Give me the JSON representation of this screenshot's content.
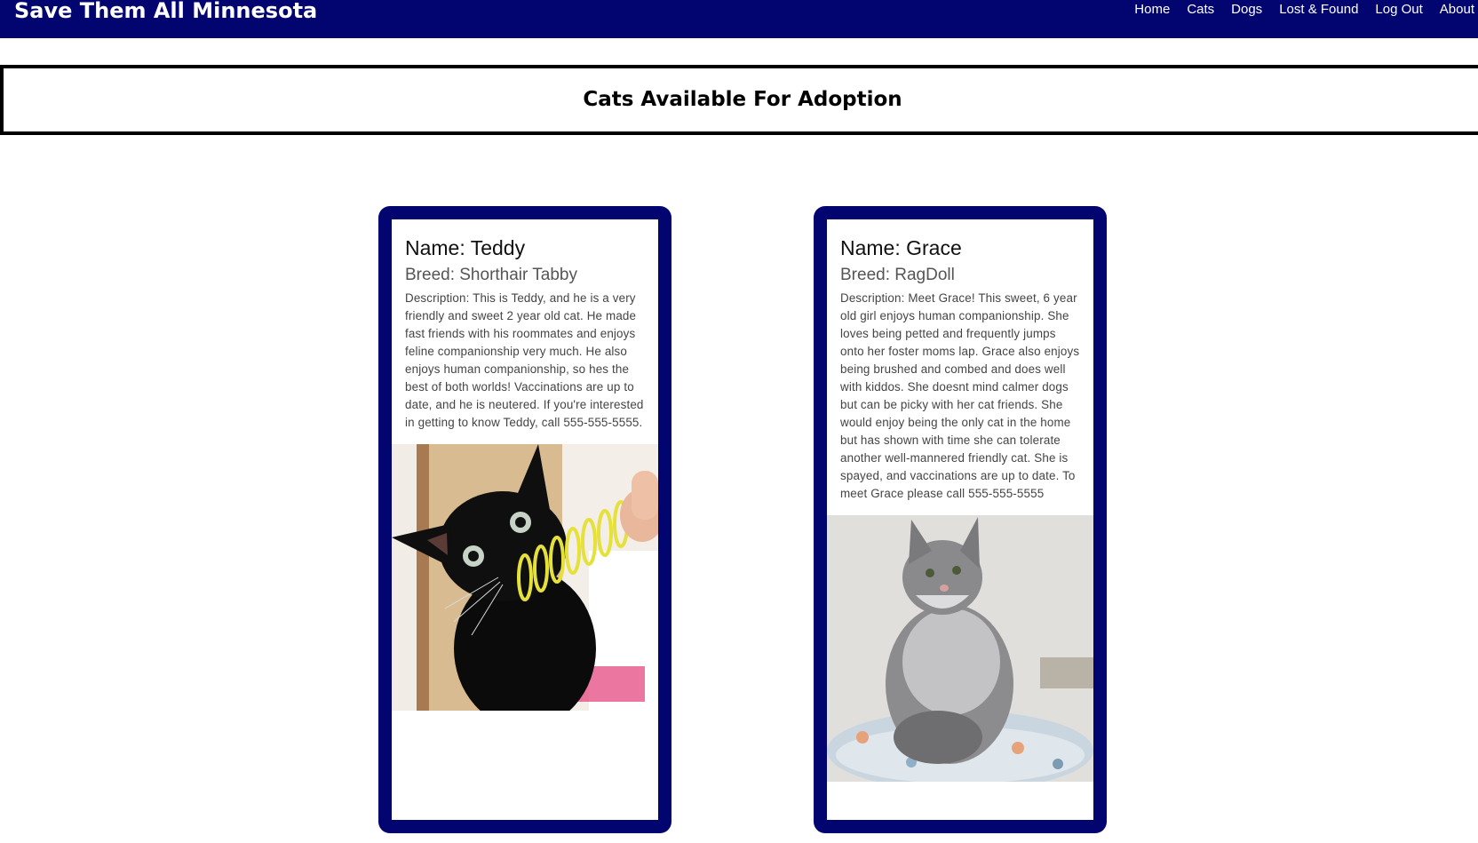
{
  "header": {
    "brand": "Save Them All Minnesota",
    "nav": [
      "Home",
      "Cats",
      "Dogs",
      "Lost & Found",
      "Log Out",
      "About"
    ]
  },
  "page": {
    "title": "Cats Available For Adoption"
  },
  "cats": [
    {
      "name": "Name: Teddy",
      "breed": "Breed: Shorthair Tabby",
      "description": "Description: This is Teddy, and he is a very friendly and sweet 2 year old cat. He made fast friends with his roommates and enjoys feline companionship very much. He also enjoys human companionship, so hes the best of both worlds! Vaccinations are up to date, and he is neutered. If you're interested in getting to know Teddy, call 555-555-5555."
    },
    {
      "name": "Name: Grace",
      "breed": "Breed: RagDoll",
      "description": "Description: Meet Grace! This sweet, 6 year old girl enjoys human companionship. She loves being petted and frequently jumps onto her foster moms lap. Grace also enjoys being brushed and combed and does well with kiddos. She doesnt mind calmer dogs but can be picky with her cat friends. She would enjoy being the only cat in the home but has shown with time she can tolerate another well-mannered friendly cat. She is spayed, and vaccinations are up to date. To meet Grace please call 555-555-5555"
    }
  ],
  "colors": {
    "navbar": "#020570",
    "card_border": "#020570",
    "heading_border": "#000000"
  }
}
